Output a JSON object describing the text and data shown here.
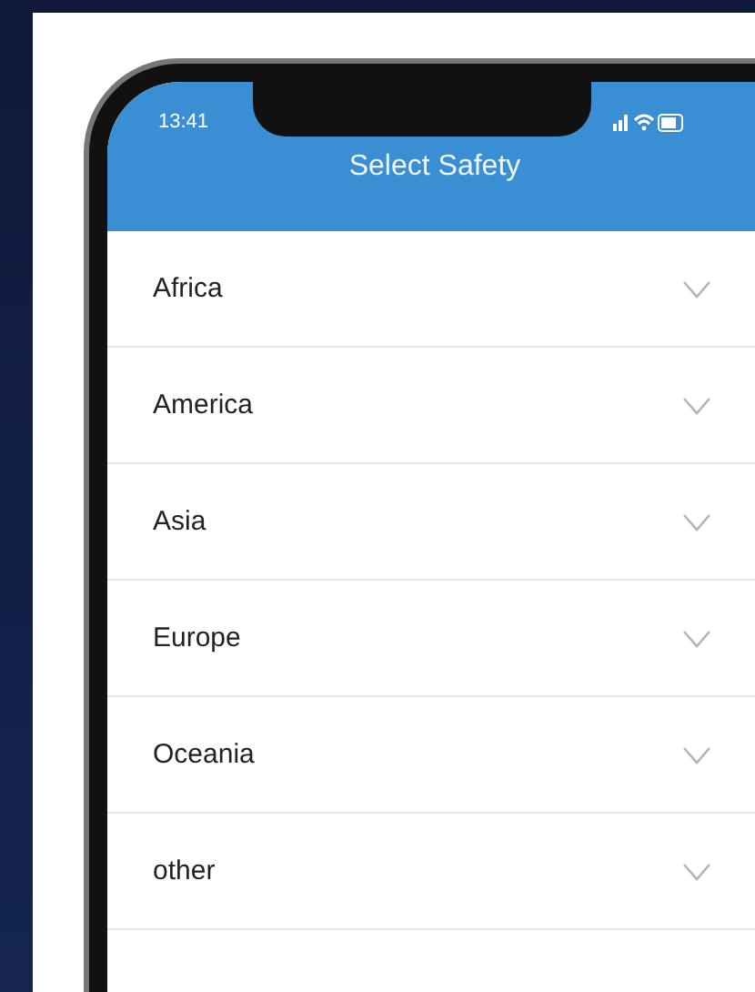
{
  "status_bar": {
    "time": "13:41"
  },
  "header": {
    "title": "Select Safety"
  },
  "regions": [
    {
      "label": "Africa",
      "expanded": false
    },
    {
      "label": "America",
      "expanded": false
    },
    {
      "label": "Asia",
      "expanded": false
    },
    {
      "label": "Europe",
      "expanded": false
    },
    {
      "label": "Oceania",
      "expanded": false
    },
    {
      "label": "other",
      "expanded": false
    }
  ]
}
